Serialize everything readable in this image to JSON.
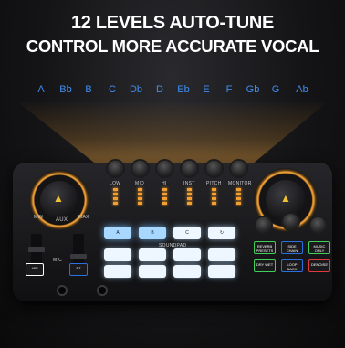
{
  "headline": {
    "line1": "12 LEVELS AUTO-TUNE",
    "line2": "CONTROL MORE ACCURATE VOCAL"
  },
  "keys": [
    "A",
    "Bb",
    "B",
    "C",
    "Db",
    "D",
    "Eb",
    "E",
    "F",
    "Gb",
    "G",
    "Ab"
  ],
  "colors": {
    "key_blue": "#3f8df0",
    "accent_orange": "#f4a030",
    "logo_yellow": "#f1c232"
  },
  "device": {
    "aux_label": "AUX",
    "min_label": "MIN",
    "max_label": "MAX",
    "knob_labels": [
      "LOW",
      "MID",
      "HI",
      "INST",
      "PITCH",
      "MONITOR"
    ],
    "soundpad_label": "SOUNDPAD",
    "pads_row1": [
      "A",
      "B",
      "C",
      ""
    ],
    "mic_label": "MIC",
    "buttons": [
      {
        "label": "REVERB PRESETS",
        "color": "#3fcf5a"
      },
      {
        "label": "SIDE CHAIN",
        "color": "#2b6fe0"
      },
      {
        "label": "MUSIC ONLY",
        "color": "#3fcf5a"
      },
      {
        "label": "DRY WET",
        "color": "#3fcf5a"
      },
      {
        "label": "LOOP BACK",
        "color": "#2b6fe0"
      },
      {
        "label": "DENOISE",
        "color": "#e23a3a"
      }
    ],
    "mute_labels": [
      "48V",
      "BT"
    ]
  }
}
